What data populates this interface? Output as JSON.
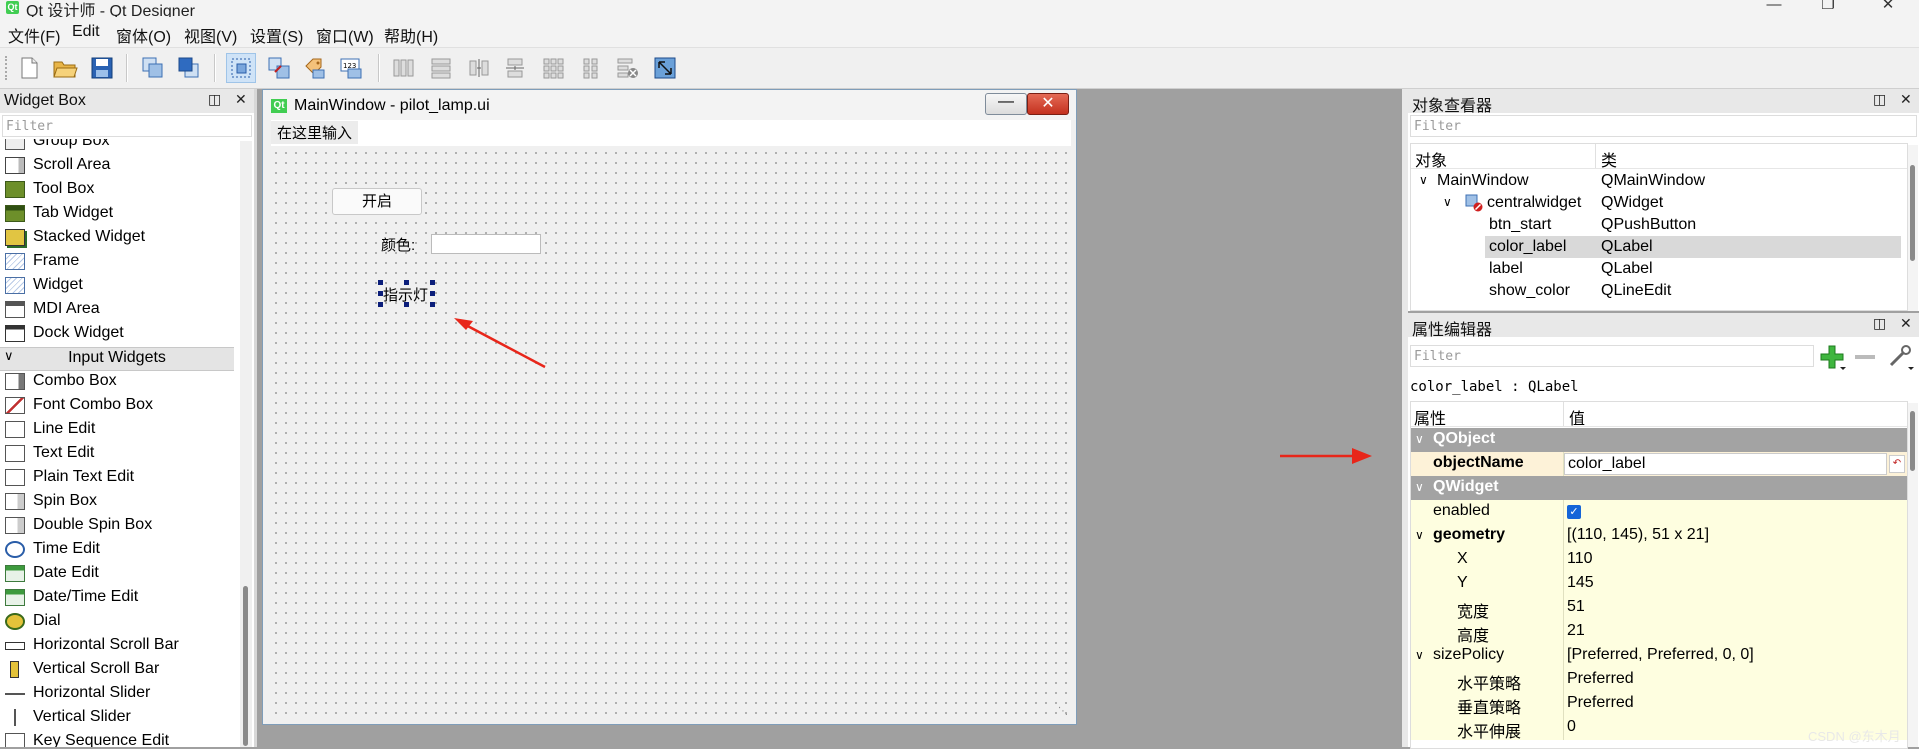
{
  "window": {
    "title": "Qt 设计师 - Qt Designer",
    "app_icon": "Qt",
    "buttons": [
      "minimize-icon",
      "restore-icon",
      "close-icon"
    ]
  },
  "menu": [
    "文件(F)",
    "Edit",
    "窗体(O)",
    "视图(V)",
    "设置(S)",
    "窗口(W)",
    "帮助(H)"
  ],
  "toolbar": {
    "icons": [
      "new-file-icon",
      "open-folder-icon",
      "save-icon",
      "send-to-back-icon",
      "bring-to-front-icon",
      "edit-widgets-icon",
      "edit-signals-slots-icon",
      "edit-buddies-icon",
      "edit-tab-order-icon",
      "layout-horizontal-icon",
      "layout-vertical-icon",
      "layout-horizontal-splitter-icon",
      "layout-vertical-splitter-icon",
      "layout-grid-icon",
      "layout-form-icon",
      "break-layout-icon",
      "adjust-size-icon"
    ]
  },
  "widget_box": {
    "title": "Widget Box",
    "filter_placeholder": "Filter",
    "partial_item": "Group Box",
    "containers": [
      "Scroll Area",
      "Tool Box",
      "Tab Widget",
      "Stacked Widget",
      "Frame",
      "Widget",
      "MDI Area",
      "Dock Widget"
    ],
    "category": "Input Widgets",
    "inputs": [
      "Combo Box",
      "Font Combo Box",
      "Line Edit",
      "Text Edit",
      "Plain Text Edit",
      "Spin Box",
      "Double Spin Box",
      "Time Edit",
      "Date Edit",
      "Date/Time Edit",
      "Dial",
      "Horizontal Scroll Bar",
      "Vertical Scroll Bar",
      "Horizontal Slider",
      "Vertical Slider",
      "Key Sequence Edit"
    ]
  },
  "form": {
    "title": "MainWindow - pilot_lamp.ui",
    "menu_placeholder": "在这里输入",
    "button_label": "开启",
    "color_label": "颜色:",
    "lamp_label": "指示灯"
  },
  "object_inspector": {
    "title": "对象查看器",
    "filter_placeholder": "Filter",
    "columns": [
      "对象",
      "类"
    ],
    "rows": [
      {
        "name": "MainWindow",
        "class": "QMainWindow"
      },
      {
        "name": "centralwidget",
        "class": "QWidget"
      },
      {
        "name": "btn_start",
        "class": "QPushButton"
      },
      {
        "name": "color_label",
        "class": "QLabel"
      },
      {
        "name": "label",
        "class": "QLabel"
      },
      {
        "name": "show_color",
        "class": "QLineEdit"
      }
    ],
    "selected_row": 3
  },
  "property_editor": {
    "title": "属性编辑器",
    "filter_placeholder": "Filter",
    "context": "color_label : QLabel",
    "columns": [
      "属性",
      "值"
    ],
    "groups": {
      "qobject": "QObject",
      "qwidget": "QWidget"
    },
    "object_name": {
      "key": "objectName",
      "value": "color_label"
    },
    "enabled": {
      "key": "enabled",
      "checked": true
    },
    "geometry": {
      "key": "geometry",
      "value": "[(110, 145), 51 x 21]"
    },
    "geometry_fields": [
      {
        "key": "X",
        "value": "110"
      },
      {
        "key": "Y",
        "value": "145"
      },
      {
        "key": "宽度",
        "value": "51"
      },
      {
        "key": "高度",
        "value": "21"
      }
    ],
    "size_policy": {
      "key": "sizePolicy",
      "value": "[Preferred, Preferred, 0, 0]"
    },
    "size_policy_fields": [
      {
        "key": "水平策略",
        "value": "Preferred"
      },
      {
        "key": "垂直策略",
        "value": "Preferred"
      },
      {
        "key": "水平伸展",
        "value": "0"
      }
    ]
  },
  "watermark": "CSDN @东木月",
  "colors": {
    "group_header": "#a3a3a3",
    "property_highlight": "#fefee0",
    "selection": "#d9d9d9",
    "arrow": "#e8261a"
  }
}
